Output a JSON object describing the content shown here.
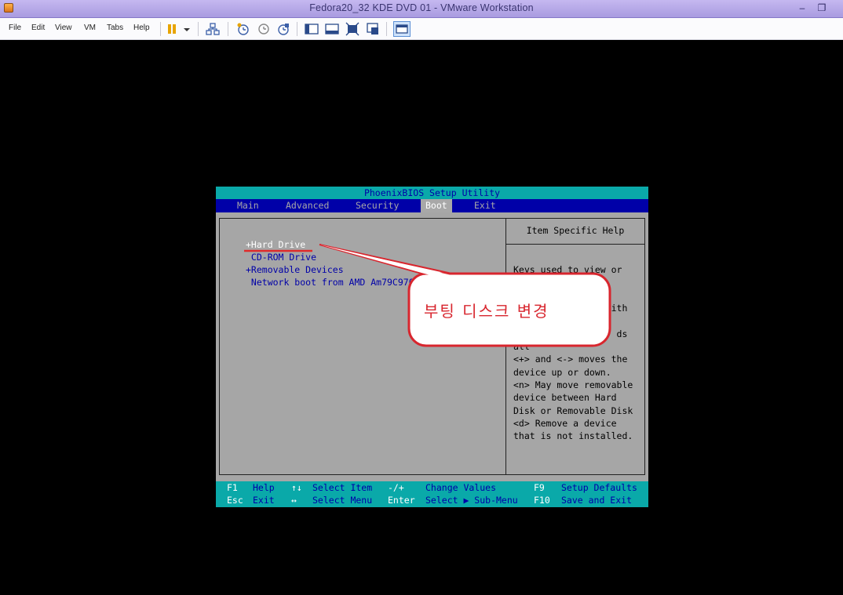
{
  "window": {
    "title": "Fedora20_32 KDE DVD 01 - VMware Workstation",
    "minimize": "–",
    "restore": "❐"
  },
  "menu": [
    "File",
    "Edit",
    "View",
    "VM",
    "Tabs",
    "Help"
  ],
  "bios": {
    "title": "PhoenixBIOS Setup Utility",
    "tabs": [
      "Main",
      "Advanced",
      "Security",
      "Boot",
      "Exit"
    ],
    "active_tab": "Boot",
    "boot_items": [
      "+Hard Drive",
      " CD-ROM Drive",
      "+Removable Devices",
      " Network boot from AMD Am79C970"
    ],
    "help_title": "Item Specific Help",
    "help_lines": [
      "Keys used to view or",
      "",
      "                 with",
      "",
      "                   ds",
      "all",
      "<+> and <-> moves the",
      "device up or down.",
      "<n> May move removable",
      "device between Hard",
      "Disk or Removable Disk",
      "<d> Remove a device",
      "that is not installed."
    ],
    "footer": {
      "row1": [
        {
          "key": "F1",
          "desc": "Help"
        },
        {
          "key": "↑↓",
          "desc": "Select Item"
        },
        {
          "key": "-/+",
          "desc": "Change Values"
        },
        {
          "key": "F9",
          "desc": "Setup Defaults"
        }
      ],
      "row2": [
        {
          "key": "Esc",
          "desc": "Exit"
        },
        {
          "key": "↔",
          "desc": "Select Menu"
        },
        {
          "key": "Enter",
          "desc": "Select ▶ Sub-Menu"
        },
        {
          "key": "F10",
          "desc": "Save and Exit"
        }
      ]
    }
  },
  "annotation": {
    "text": "부팅 디스크 변경",
    "color": "#d8262e"
  },
  "colors": {
    "bios_blue": "#0000a8",
    "bios_cyan": "#0aa9a9",
    "bios_gray": "#a6a6a6"
  }
}
